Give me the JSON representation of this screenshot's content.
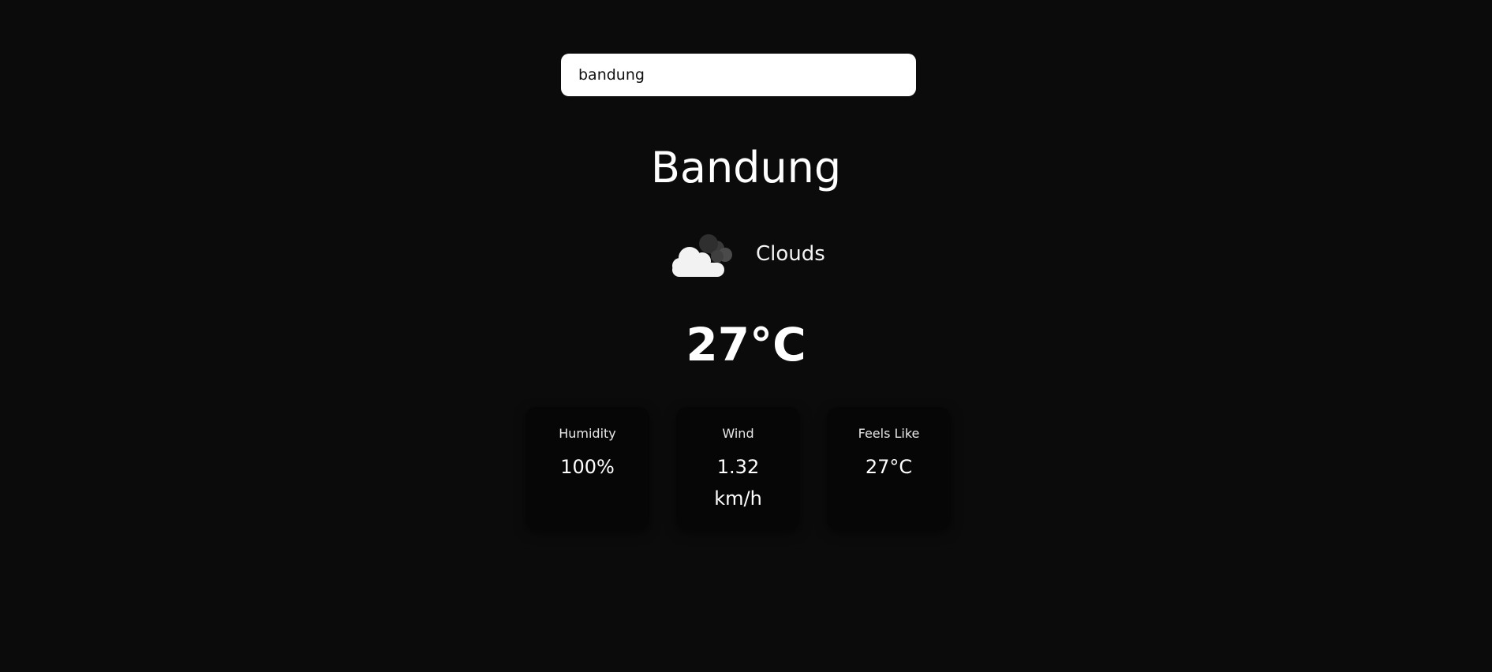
{
  "search": {
    "value": "bandung"
  },
  "weather": {
    "city": "Bandung",
    "condition": "Clouds",
    "condition_icon": "clouds-icon",
    "temperature": "27°C"
  },
  "stats": [
    {
      "title": "Humidity",
      "value": "100%"
    },
    {
      "title": "Wind",
      "value": "1.32 km/h"
    },
    {
      "title": "Feels Like",
      "value": "27°C"
    }
  ],
  "colors": {
    "background": "#0b0b0b",
    "card": "#060606",
    "search_bg": "#ffffff",
    "text": "#ffffff"
  }
}
